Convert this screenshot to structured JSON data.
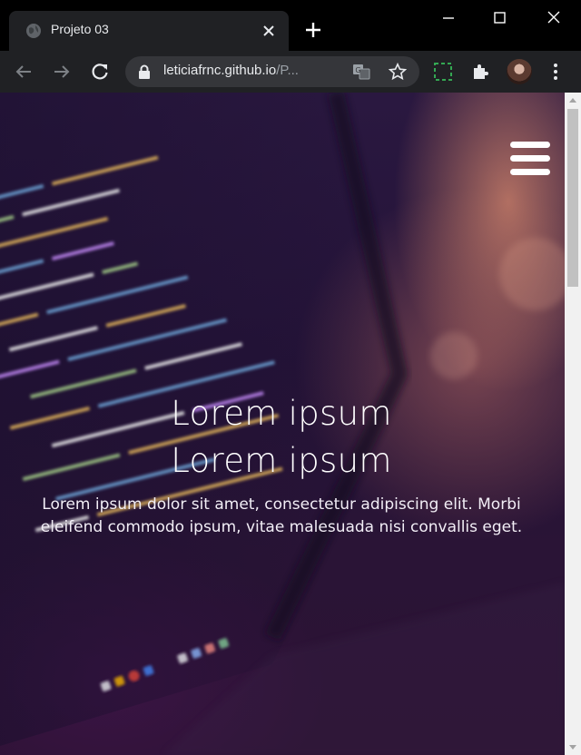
{
  "browser": {
    "tab_title": "Projeto 03",
    "url_host": "leticiafrnc.github.io",
    "url_path": "/P...",
    "icons": {
      "favicon": "globe-icon",
      "close": "close-icon",
      "new_tab": "plus-icon",
      "back": "arrow-left-icon",
      "forward": "arrow-right-icon",
      "reload": "reload-icon",
      "lock": "lock-icon",
      "translate": "translate-icon",
      "bookmark": "star-icon",
      "extension": "puzzle-icon",
      "menu": "more-vertical-icon"
    }
  },
  "page": {
    "menu_icon": "hamburger-menu-icon",
    "title_line1": "Lorem ipsum",
    "title_line2": "Lorem ipsum",
    "description": "Lorem ipsum dolor sit amet, consectetur adipiscing elit. Morbi eleifend commodo ipsum, vitae malesuada nisi convallis eget.",
    "colors": {
      "overlay": "#2a1840",
      "text": "#ffffff",
      "accent_glow": "#de8c6e"
    }
  }
}
